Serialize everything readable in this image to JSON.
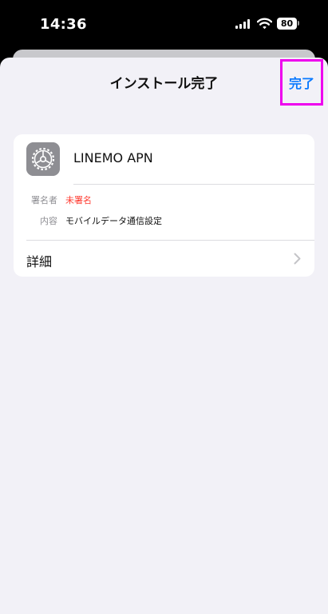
{
  "status_bar": {
    "time": "14:36",
    "battery": "80"
  },
  "sheet": {
    "title": "インストール完了",
    "done_label": "完了"
  },
  "profile": {
    "name": "LINEMO APN",
    "icon": "settings-gear-icon",
    "signer_label": "署名者",
    "signer_value": "未署名",
    "content_label": "内容",
    "content_value": "モバイルデータ通信設定",
    "details_label": "詳細"
  },
  "colors": {
    "accent": "#0a7aff",
    "unsigned": "#ff3b30",
    "highlight": "#ee00ee",
    "background": "#f2f1f7"
  }
}
